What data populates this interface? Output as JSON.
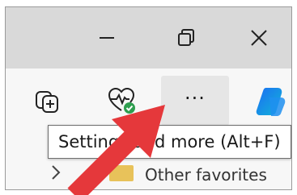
{
  "window_controls": {
    "minimize_icon": "minimize-icon",
    "restore_icon": "restore-icon",
    "close_icon": "close-icon"
  },
  "toolbar": {
    "collections_icon": "collections-icon",
    "browser_essentials_icon": "browser-essentials-icon",
    "more_label": "···",
    "copilot_icon": "copilot-icon"
  },
  "favorites": {
    "folder_label": "Other favorites"
  },
  "tooltip": {
    "text": "Settings and more (Alt+F)"
  },
  "colors": {
    "annotation_arrow": "#e5383b",
    "titlebar": "#d9d9d9",
    "toolbar": "#f7f7f7",
    "hover": "#e6e6e6"
  }
}
